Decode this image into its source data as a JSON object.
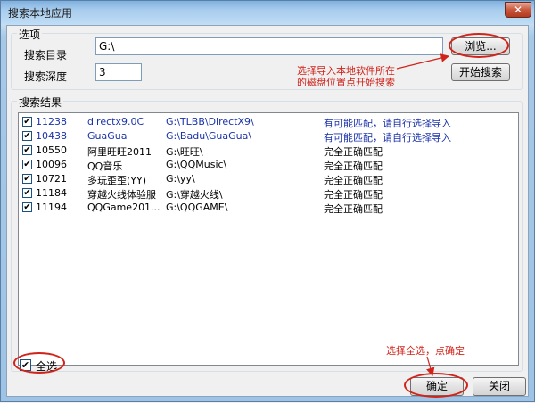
{
  "window": {
    "title": "搜索本地应用",
    "close_glyph": "✕"
  },
  "options": {
    "caption": "选项",
    "dir_label": "搜索目录",
    "dir_value": "G:\\",
    "depth_label": "搜索深度",
    "depth_value": "3",
    "browse_label": "浏览...",
    "search_label": "开始搜索"
  },
  "results": {
    "caption": "搜索结果",
    "rows": [
      {
        "checked": "✔",
        "id": "11238",
        "name": "directx9.0C",
        "path": "G:\\TLBB\\DirectX9\\",
        "status": "有可能匹配，请自行选择导入"
      },
      {
        "checked": "✔",
        "id": "10438",
        "name": "GuaGua",
        "path": "G:\\Badu\\GuaGua\\",
        "status": "有可能匹配，请自行选择导入"
      },
      {
        "checked": "✔",
        "id": "10550",
        "name": "阿里旺旺2011",
        "path": "G:\\旺旺\\",
        "status": "完全正确匹配"
      },
      {
        "checked": "✔",
        "id": "10096",
        "name": "QQ音乐",
        "path": "G:\\QQMusic\\",
        "status": "完全正确匹配"
      },
      {
        "checked": "✔",
        "id": "10721",
        "name": "多玩歪歪(YY)",
        "path": "G:\\yy\\",
        "status": "完全正确匹配"
      },
      {
        "checked": "✔",
        "id": "11184",
        "name": "穿越火线体验服",
        "path": "G:\\穿越火线\\",
        "status": "完全正确匹配"
      },
      {
        "checked": "✔",
        "id": "11194",
        "name": "QQGame201...",
        "path": "G:\\QQGAME\\",
        "status": "完全正确匹配"
      }
    ]
  },
  "footer": {
    "select_all_checked": "✔",
    "select_all_label": "全选",
    "ok_label": "确定",
    "close_label": "关闭"
  },
  "annotations": {
    "browse_hint_line1": "选择导入本地软件所在",
    "browse_hint_line2": "的磁盘位置点开始搜索",
    "select_hint": "选择全选，点确定"
  },
  "colors": {
    "annotation": "#d0241b",
    "uncertain_row": "#1a32a8"
  }
}
